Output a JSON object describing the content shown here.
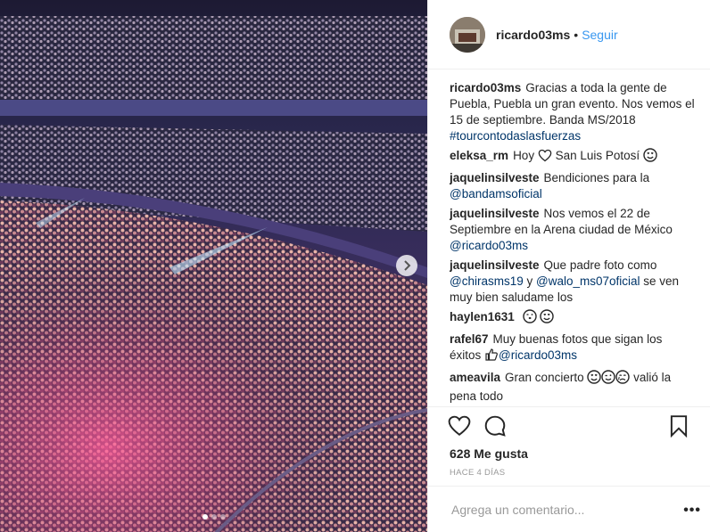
{
  "post": {
    "author": "ricardo03ms",
    "separator": "•",
    "follow_label": "Seguir"
  },
  "caption": {
    "user": "ricardo03ms",
    "text": "Gracias a toda la gente de Puebla, Puebla un gran evento. Nos vemos el 15 de septiembre. Banda MS/2018 ",
    "hashtag": "#tourcontodaslasfuerzas"
  },
  "comments": [
    {
      "user": "eleksa_rm",
      "t1": "Hoy",
      "t2": "San Luis Potosí"
    },
    {
      "user": "jaquelinsilveste",
      "t1": "Bendiciones para la ",
      "mention": "@bandamsoficial"
    },
    {
      "user": "jaquelinsilveste",
      "t1": "Nos vemos el 22 de Septiembre en la Arena ciudad de México ",
      "mention": "@ricardo03ms"
    },
    {
      "user": "jaquelinsilveste",
      "t1": "Que padre foto como ",
      "mention": "@chirasms19",
      "t2": " y ",
      "mention2": "@walo_ms07oficial",
      "t3": " se ven muy bien saludame los"
    },
    {
      "user": "haylen1631"
    },
    {
      "user": "rafel67",
      "t1": "Muy buenas fotos que sigan los éxitos ",
      "mention": "@ricardo03ms"
    },
    {
      "user": "ameavila",
      "t1": "Gran concierto ",
      "t2": " valió la pena todo"
    }
  ],
  "likes": "628 Me gusta",
  "date": "HACE 4 DÍAS",
  "add_comment_placeholder": "Agrega un comentario...",
  "more_label": "•••",
  "icons": {
    "like": "heart-icon",
    "comment": "comment-bubble-icon",
    "save": "bookmark-icon",
    "next": "chevron-right-icon"
  },
  "colors": {
    "link": "#003569",
    "follow": "#3897f0",
    "muted": "#999999"
  },
  "carousel": {
    "slides": 3,
    "active": 1
  }
}
